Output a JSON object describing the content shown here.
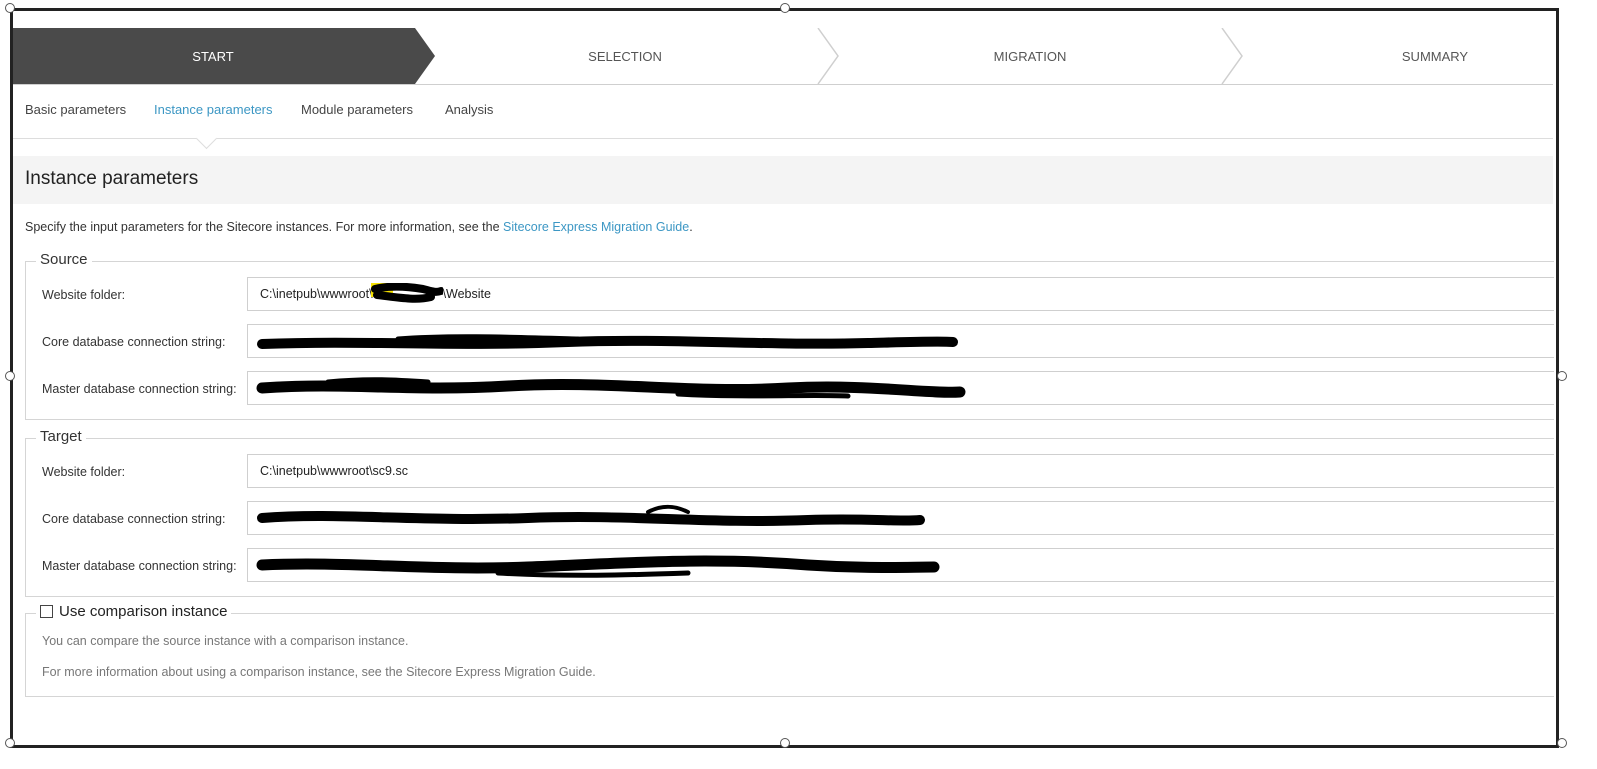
{
  "wizard": {
    "steps": [
      {
        "label": "START",
        "active": true
      },
      {
        "label": "SELECTION",
        "active": false
      },
      {
        "label": "MIGRATION",
        "active": false
      },
      {
        "label": "SUMMARY",
        "active": false
      }
    ],
    "active_color": "#4a4a4a"
  },
  "subtabs": [
    {
      "label": "Basic parameters",
      "active": false
    },
    {
      "label": "Instance parameters",
      "active": true
    },
    {
      "label": "Module parameters",
      "active": false
    },
    {
      "label": "Analysis",
      "active": false
    }
  ],
  "page": {
    "title": "Instance parameters",
    "intro_text": "Specify the input parameters for the Sitecore instances. For more information, see the ",
    "intro_link": "Sitecore Express Migration Guide",
    "intro_end": "."
  },
  "source": {
    "legend": "Source",
    "website_folder_label": "Website folder:",
    "website_folder_value": "C:\\inetpub\\wwwroot\\",
    "website_folder_suffix": "\\Website",
    "core_label": "Core database connection string:",
    "master_label": "Master database connection string:"
  },
  "target": {
    "legend": "Target",
    "website_folder_label": "Website folder:",
    "website_folder_value": "C:\\inetpub\\wwwroot\\sc9.sc",
    "core_label": "Core database connection string:",
    "master_label": "Master database connection string:"
  },
  "comparison": {
    "checkbox_label": "Use comparison instance",
    "checked": false,
    "note1": "You can compare the source instance with a comparison instance.",
    "note2": "For more information about using a comparison instance, see the Sitecore Express Migration Guide."
  },
  "colors": {
    "link": "#3c97c4",
    "highlight": "#f5e100",
    "redaction": "#000000"
  }
}
